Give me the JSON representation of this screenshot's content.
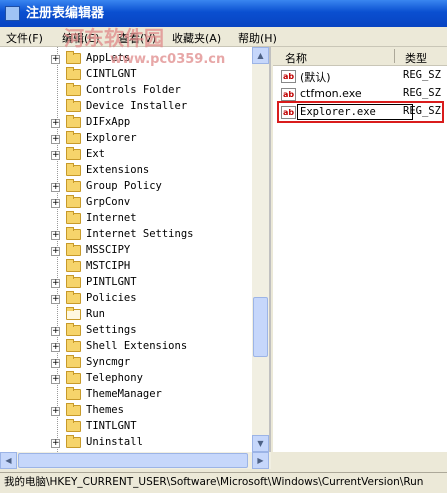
{
  "window": {
    "title": "注册表编辑器",
    "watermark_line1": "河东软件园",
    "watermark_line2": "www.pc0359.cn"
  },
  "menu": [
    "文件(F)",
    "编辑(E)",
    "查看(V)",
    "收藏夹(A)",
    "帮助(H)"
  ],
  "tree": [
    {
      "label": "AppLets",
      "expander": true,
      "open": false
    },
    {
      "label": "CINTLGNT",
      "expander": false,
      "open": false
    },
    {
      "label": "Controls Folder",
      "expander": false,
      "open": false
    },
    {
      "label": "Device Installer",
      "expander": false,
      "open": false
    },
    {
      "label": "DIFxApp",
      "expander": true,
      "open": false
    },
    {
      "label": "Explorer",
      "expander": true,
      "open": false
    },
    {
      "label": "Ext",
      "expander": true,
      "open": false
    },
    {
      "label": "Extensions",
      "expander": false,
      "open": false
    },
    {
      "label": "Group Policy",
      "expander": true,
      "open": false
    },
    {
      "label": "GrpConv",
      "expander": true,
      "open": false
    },
    {
      "label": "Internet",
      "expander": false,
      "open": false
    },
    {
      "label": "Internet Settings",
      "expander": true,
      "open": false
    },
    {
      "label": "MSSCIPY",
      "expander": true,
      "open": false
    },
    {
      "label": "MSTCIPH",
      "expander": false,
      "open": false
    },
    {
      "label": "PINTLGNT",
      "expander": true,
      "open": false
    },
    {
      "label": "Policies",
      "expander": true,
      "open": false
    },
    {
      "label": "Run",
      "expander": false,
      "open": true
    },
    {
      "label": "Settings",
      "expander": true,
      "open": false
    },
    {
      "label": "Shell Extensions",
      "expander": true,
      "open": false
    },
    {
      "label": "Syncmgr",
      "expander": true,
      "open": false
    },
    {
      "label": "Telephony",
      "expander": true,
      "open": false
    },
    {
      "label": "ThemeManager",
      "expander": false,
      "open": false
    },
    {
      "label": "Themes",
      "expander": true,
      "open": false
    },
    {
      "label": "TINTLGNT",
      "expander": false,
      "open": false
    },
    {
      "label": "Uninstall",
      "expander": true,
      "open": false
    }
  ],
  "list": {
    "columns": {
      "name": "名称",
      "type": "类型"
    },
    "rows": [
      {
        "name": "(默认)",
        "type": "REG_SZ",
        "editing": false
      },
      {
        "name": "ctfmon.exe",
        "type": "REG_SZ",
        "editing": false
      },
      {
        "name": "Explorer.exe",
        "type": "REG_SZ",
        "editing": true
      }
    ]
  },
  "status": {
    "path": "我的电脑\\HKEY_CURRENT_USER\\Software\\Microsoft\\Windows\\CurrentVersion\\Run"
  },
  "colors": {
    "highlight_box": "#d91c1c",
    "title_bar": "#0a4fd0"
  }
}
